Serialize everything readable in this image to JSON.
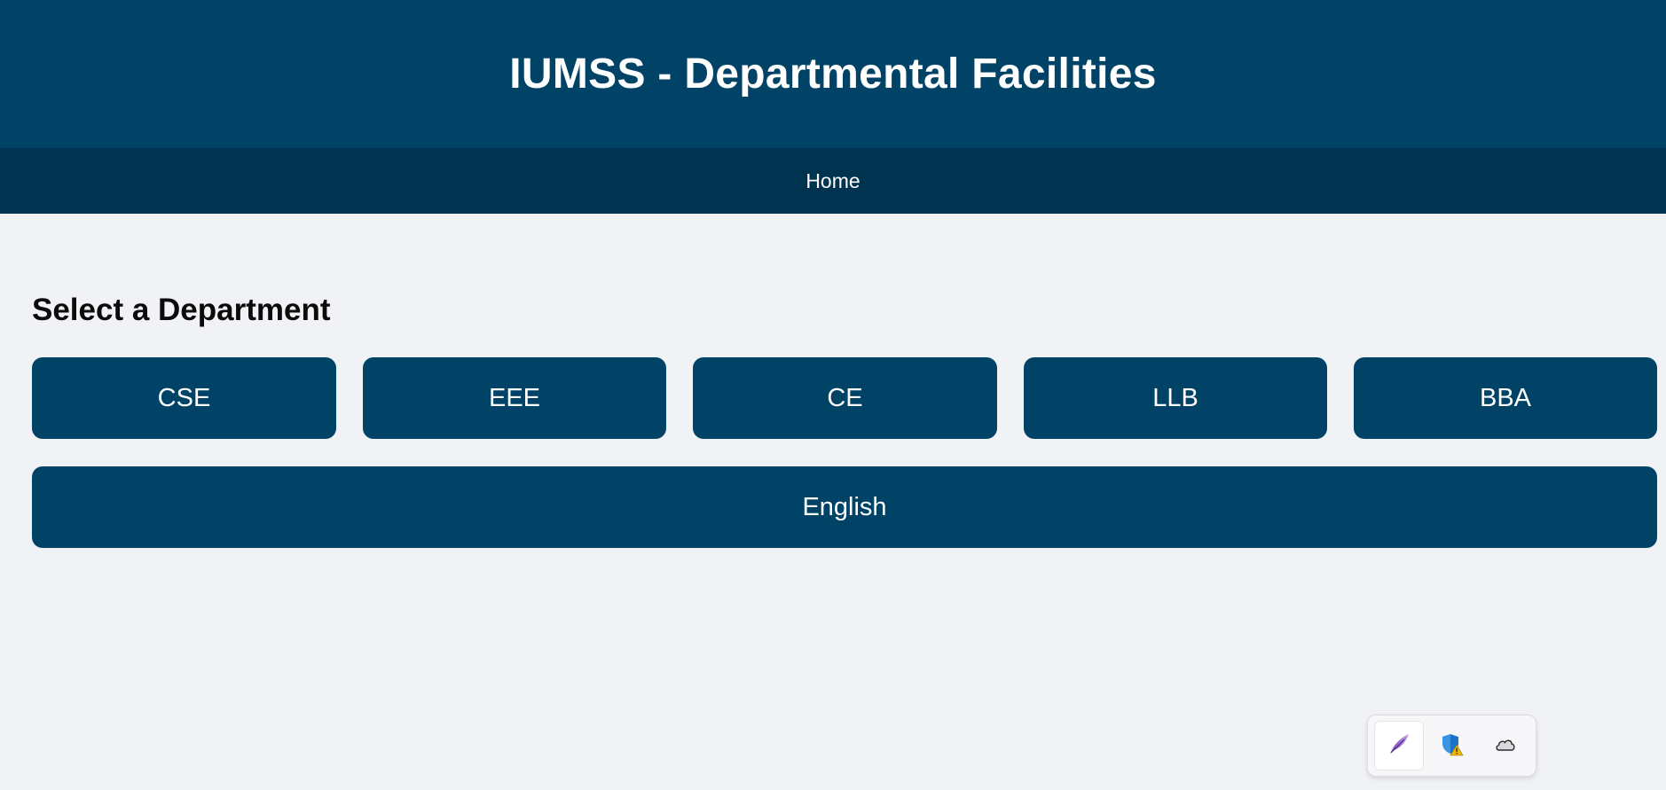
{
  "header": {
    "title": "IUMSS - Departmental Facilities"
  },
  "nav": {
    "home_label": "Home"
  },
  "main": {
    "section_title": "Select a Department",
    "departments": [
      "CSE",
      "EEE",
      "CE",
      "LLB",
      "BBA",
      "English"
    ]
  },
  "tray": {
    "icons": [
      "pen-icon",
      "shield-warning-icon",
      "cloud-icon"
    ]
  },
  "colors": {
    "header_bg": "#014366",
    "nav_bg": "#003350",
    "page_bg": "#f0f2f6",
    "button_bg": "#014366",
    "button_text": "#ffffff"
  }
}
